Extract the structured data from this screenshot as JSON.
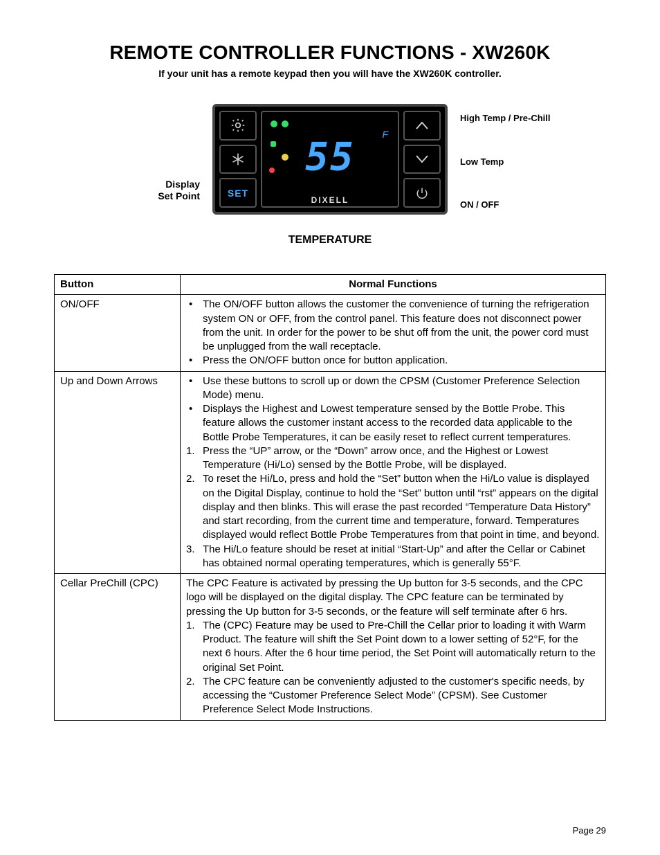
{
  "page": {
    "title": "REMOTE CONTROLLER FUNCTIONS - XW260K",
    "subtitle": "If  your unit has a remote keypad then you will have the XW260K controller.",
    "section_heading": "TEMPERATURE",
    "page_number": "Page 29"
  },
  "controller": {
    "left_label_line1": "Display",
    "left_label_line2": "Set Point",
    "right_labels": {
      "up": "High Temp / Pre-Chill",
      "down": "Low Temp",
      "power": "ON / OFF"
    },
    "display_value": "55",
    "display_unit": "F",
    "brand": "DIXELL",
    "set_label": "SET"
  },
  "table": {
    "headers": {
      "button": "Button",
      "normal_functions": "Normal Functions"
    },
    "rows": [
      {
        "button": "ON/OFF",
        "bullets": [
          "The ON/OFF button allows the customer the convenience of turning the refrigeration system ON or OFF, from the control panel.  This feature does not disconnect power from the unit.  In order for the power to be shut off from the unit, the power cord must be unplugged from the wall receptacle.",
          "Press the ON/OFF button once for button application."
        ]
      },
      {
        "button": "Up and Down Arrows",
        "bullets": [
          "Use these buttons to scroll up or down the CPSM (Customer Preference Selection Mode) menu.",
          "Displays the Highest and Lowest temperature sensed by the Bottle Probe.  This feature allows the customer instant access to the recorded data applicable to the Bottle Probe Temperatures, it can be easily reset to reflect current temperatures."
        ],
        "numbers": [
          "Press the “UP” arrow, or the “Down” arrow once, and the Highest or Lowest Temperature (Hi/Lo) sensed by the Bottle Probe, will be displayed.",
          "To reset the Hi/Lo, press and hold the “Set” button when the Hi/Lo value is displayed on the Digital Display, continue to hold the “Set” button until “rst” appears on the digital display and then blinks.  This will erase the past recorded “Temperature Data History” and start recording, from the current time and temperature, forward.  Temperatures displayed would reflect Bottle Probe Temperatures from that point in time, and beyond.",
          "The Hi/Lo feature should be reset at initial “Start-Up” and after the Cellar or Cabinet has obtained normal operating temperatures, which is generally 55°F."
        ]
      },
      {
        "button": "Cellar PreChill (CPC)",
        "intro": "The CPC Feature is activated by pressing the Up button for 3-5 seconds, and the CPC logo will be displayed on the digital display.  The CPC feature can be terminated by pressing the Up button for 3-5 seconds, or the feature will self terminate after 6 hrs.",
        "numbers": [
          "The (CPC) Feature may be used to Pre-Chill the Cellar prior to loading it with Warm Product.  The feature will shift the Set Point down to a lower setting of 52°F, for the next 6 hours.  After the 6 hour time period, the Set Point will automatically return to the original Set Point.",
          "The CPC feature can be conveniently adjusted to the customer's specific needs, by accessing the “Customer Preference Select Mode” (CPSM).  See Customer Preference Select Mode Instructions."
        ]
      }
    ]
  }
}
